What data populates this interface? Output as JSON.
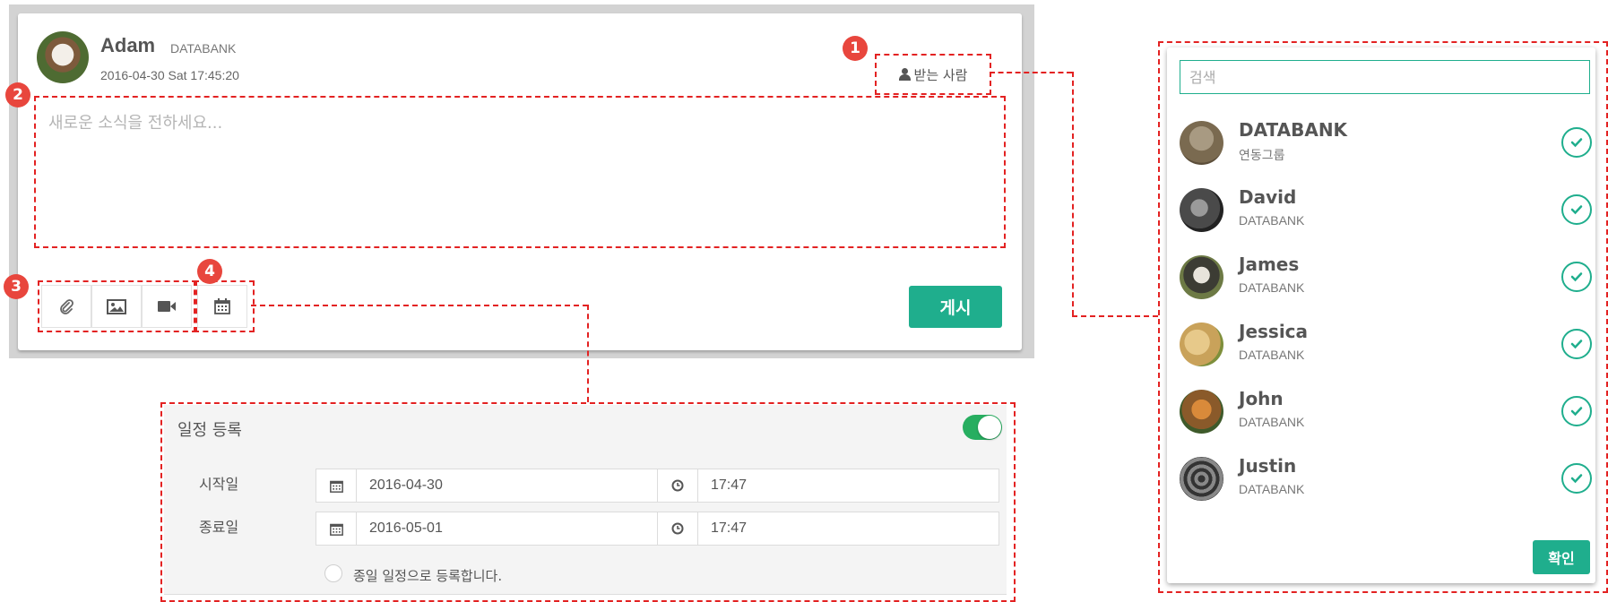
{
  "composer": {
    "author_name": "Adam",
    "author_org": "DATABANK",
    "timestamp": "2016-04-30 Sat 17:45:20",
    "recipient_button_label": "받는 사람",
    "placeholder": "새로운 소식을 전하세요...",
    "post_button_label": "게시",
    "tools": [
      "paperclip-icon",
      "image-icon",
      "video-camera-icon",
      "calendar-icon"
    ]
  },
  "callouts": [
    "1",
    "2",
    "3",
    "4"
  ],
  "schedule": {
    "title": "일정 등록",
    "toggle_on": true,
    "start_label": "시작일",
    "start_date": "2016-04-30",
    "start_time": "17:47",
    "end_label": "종료일",
    "end_date": "2016-05-01",
    "end_time": "17:47",
    "allday_label": "종일 일정으로 등록합니다."
  },
  "recipients": {
    "search_placeholder": "검색",
    "items": [
      {
        "name": "DATABANK",
        "sub": "연동그룹",
        "selected": true
      },
      {
        "name": "David",
        "sub": "DATABANK",
        "selected": true
      },
      {
        "name": "James",
        "sub": "DATABANK",
        "selected": true
      },
      {
        "name": "Jessica",
        "sub": "DATABANK",
        "selected": true
      },
      {
        "name": "John",
        "sub": "DATABANK",
        "selected": true
      },
      {
        "name": "Justin",
        "sub": "DATABANK",
        "selected": true
      }
    ],
    "confirm_label": "확인"
  },
  "colors": {
    "accent": "#1fae8d",
    "callout": "#e8463d",
    "dash": "#e32222",
    "toggle": "#27ae60"
  }
}
